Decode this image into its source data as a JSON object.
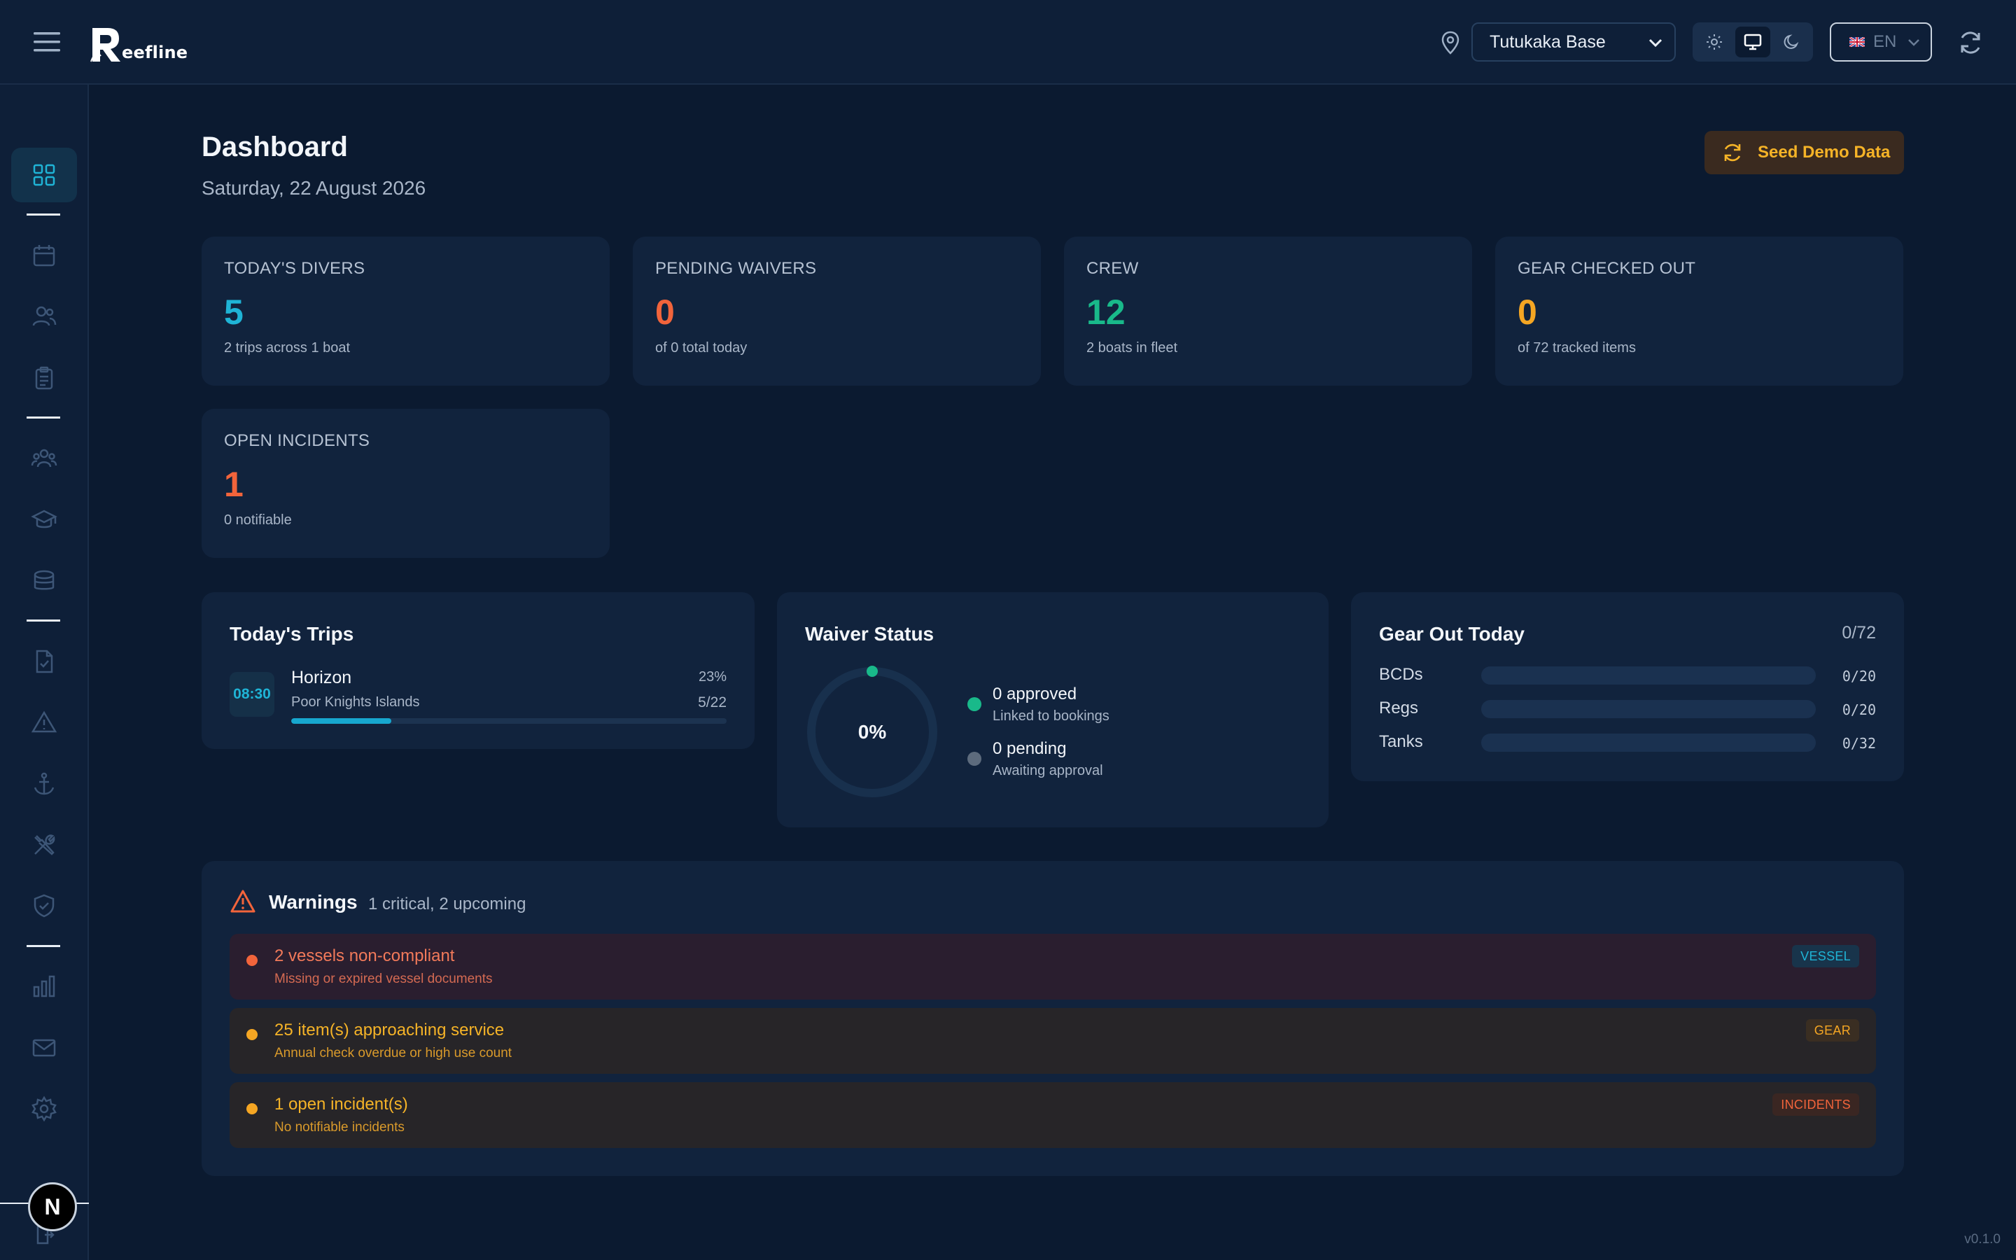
{
  "app": {
    "name": "Reefline",
    "logo_letter": "R",
    "logo_rest": "eefline",
    "version": "v0.1.0"
  },
  "topbar": {
    "location": "Tutukaka Base",
    "language": "EN",
    "theme_active": "system"
  },
  "sidebar": {
    "items": [
      "dashboard-icon",
      "calendar-icon",
      "users-icon",
      "clipboard-icon",
      "group-icon",
      "graduation-cap-icon",
      "briefcase-icon",
      "document-check-icon",
      "warning-icon",
      "anchor-icon",
      "tools-icon",
      "shield-check-icon",
      "bar-chart-icon",
      "mail-icon",
      "gear-icon"
    ],
    "avatar_letter": "N"
  },
  "header": {
    "title": "Dashboard",
    "date": "Saturday, 22 August 2026",
    "seed_label": "Seed Demo Data"
  },
  "stats": [
    {
      "label": "TODAY'S DIVERS",
      "value": "5",
      "sub": "2 trips across 1 boat",
      "color": "#1fb4d6"
    },
    {
      "label": "PENDING WAIVERS",
      "value": "0",
      "sub": "of 0 total today",
      "color": "#f2643b"
    },
    {
      "label": "CREW",
      "value": "12",
      "sub": "2 boats in fleet",
      "color": "#19b98a"
    },
    {
      "label": "GEAR CHECKED OUT",
      "value": "0",
      "sub": "of 72 tracked items",
      "color": "#f5a623"
    },
    {
      "label": "OPEN INCIDENTS",
      "value": "1",
      "sub": "0 notifiable",
      "color": "#f2643b"
    }
  ],
  "trips": {
    "title": "Today's Trips",
    "items": [
      {
        "time": "08:30",
        "name": "Horizon",
        "location": "Poor Knights Islands",
        "percent_label": "23%",
        "count": "5/22",
        "fill": 0.23
      }
    ]
  },
  "waivers": {
    "title": "Waiver Status",
    "percent_label": "0%",
    "approved": "0 approved",
    "approved_sub": "Linked to bookings",
    "pending": "0 pending",
    "pending_sub": "Awaiting approval",
    "approved_color": "#19b98a",
    "pending_color": "#5d6b7d"
  },
  "gear": {
    "title": "Gear Out Today",
    "total": "0/72",
    "rows": [
      {
        "label": "BCDs",
        "value": "0/20",
        "fill": 0
      },
      {
        "label": "Regs",
        "value": "0/20",
        "fill": 0
      },
      {
        "label": "Tanks",
        "value": "0/32",
        "fill": 0
      }
    ]
  },
  "warnings": {
    "title": "Warnings",
    "summary": "1 critical, 2 upcoming",
    "items": [
      {
        "title": "2 vessels non-compliant",
        "desc": "Missing or expired vessel documents",
        "tag": "VESSEL",
        "severity": "critical"
      },
      {
        "title": "25 item(s) approaching service",
        "desc": "Annual check overdue or high use count",
        "tag": "GEAR",
        "severity": "upcoming"
      },
      {
        "title": "1 open incident(s)",
        "desc": "No notifiable incidents",
        "tag": "INCIDENTS",
        "severity": "upcoming"
      }
    ]
  }
}
